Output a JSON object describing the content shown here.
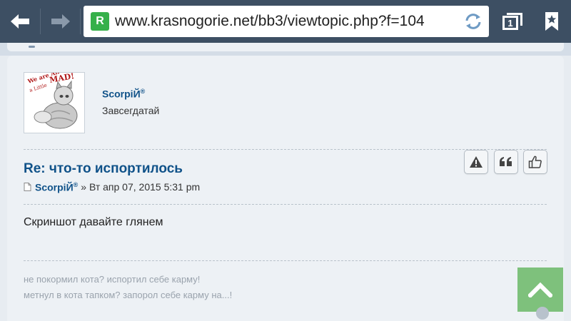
{
  "browser": {
    "url": "www.krasnogorie.net/bb3/viewtopic.php?f=104",
    "favicon_letter": "R",
    "tab_count": "1",
    "icons": {
      "back": "arrow-left-icon",
      "forward": "arrow-right-icon",
      "reload": "reload-icon",
      "tabs": "tabs-icon",
      "bookmark": "bookmark-star-icon"
    }
  },
  "post": {
    "author": "ScorpiЙ",
    "author_mark": "®",
    "rank": "Завсегдатай",
    "avatar_text": "We are All a Little MAD!",
    "title": "Re: что-то испортилось",
    "date_separator": "»",
    "date": "Вт апр 07, 2015 5:31 pm",
    "content": "Скриншот давайте глянем",
    "signature": [
      "не покормил кота? испортил себе карму!",
      "метнул в кота тапком? запорол себе карму на...!"
    ],
    "actions": {
      "report_icon": "warning-icon",
      "quote_icon": "quote-icon",
      "like_icon": "thumbs-up-icon"
    }
  },
  "colors": {
    "toolbar": "#3d4f63",
    "link": "#105289",
    "post_bg": "#edf1f5",
    "scroll_top": "#7ec17c"
  }
}
